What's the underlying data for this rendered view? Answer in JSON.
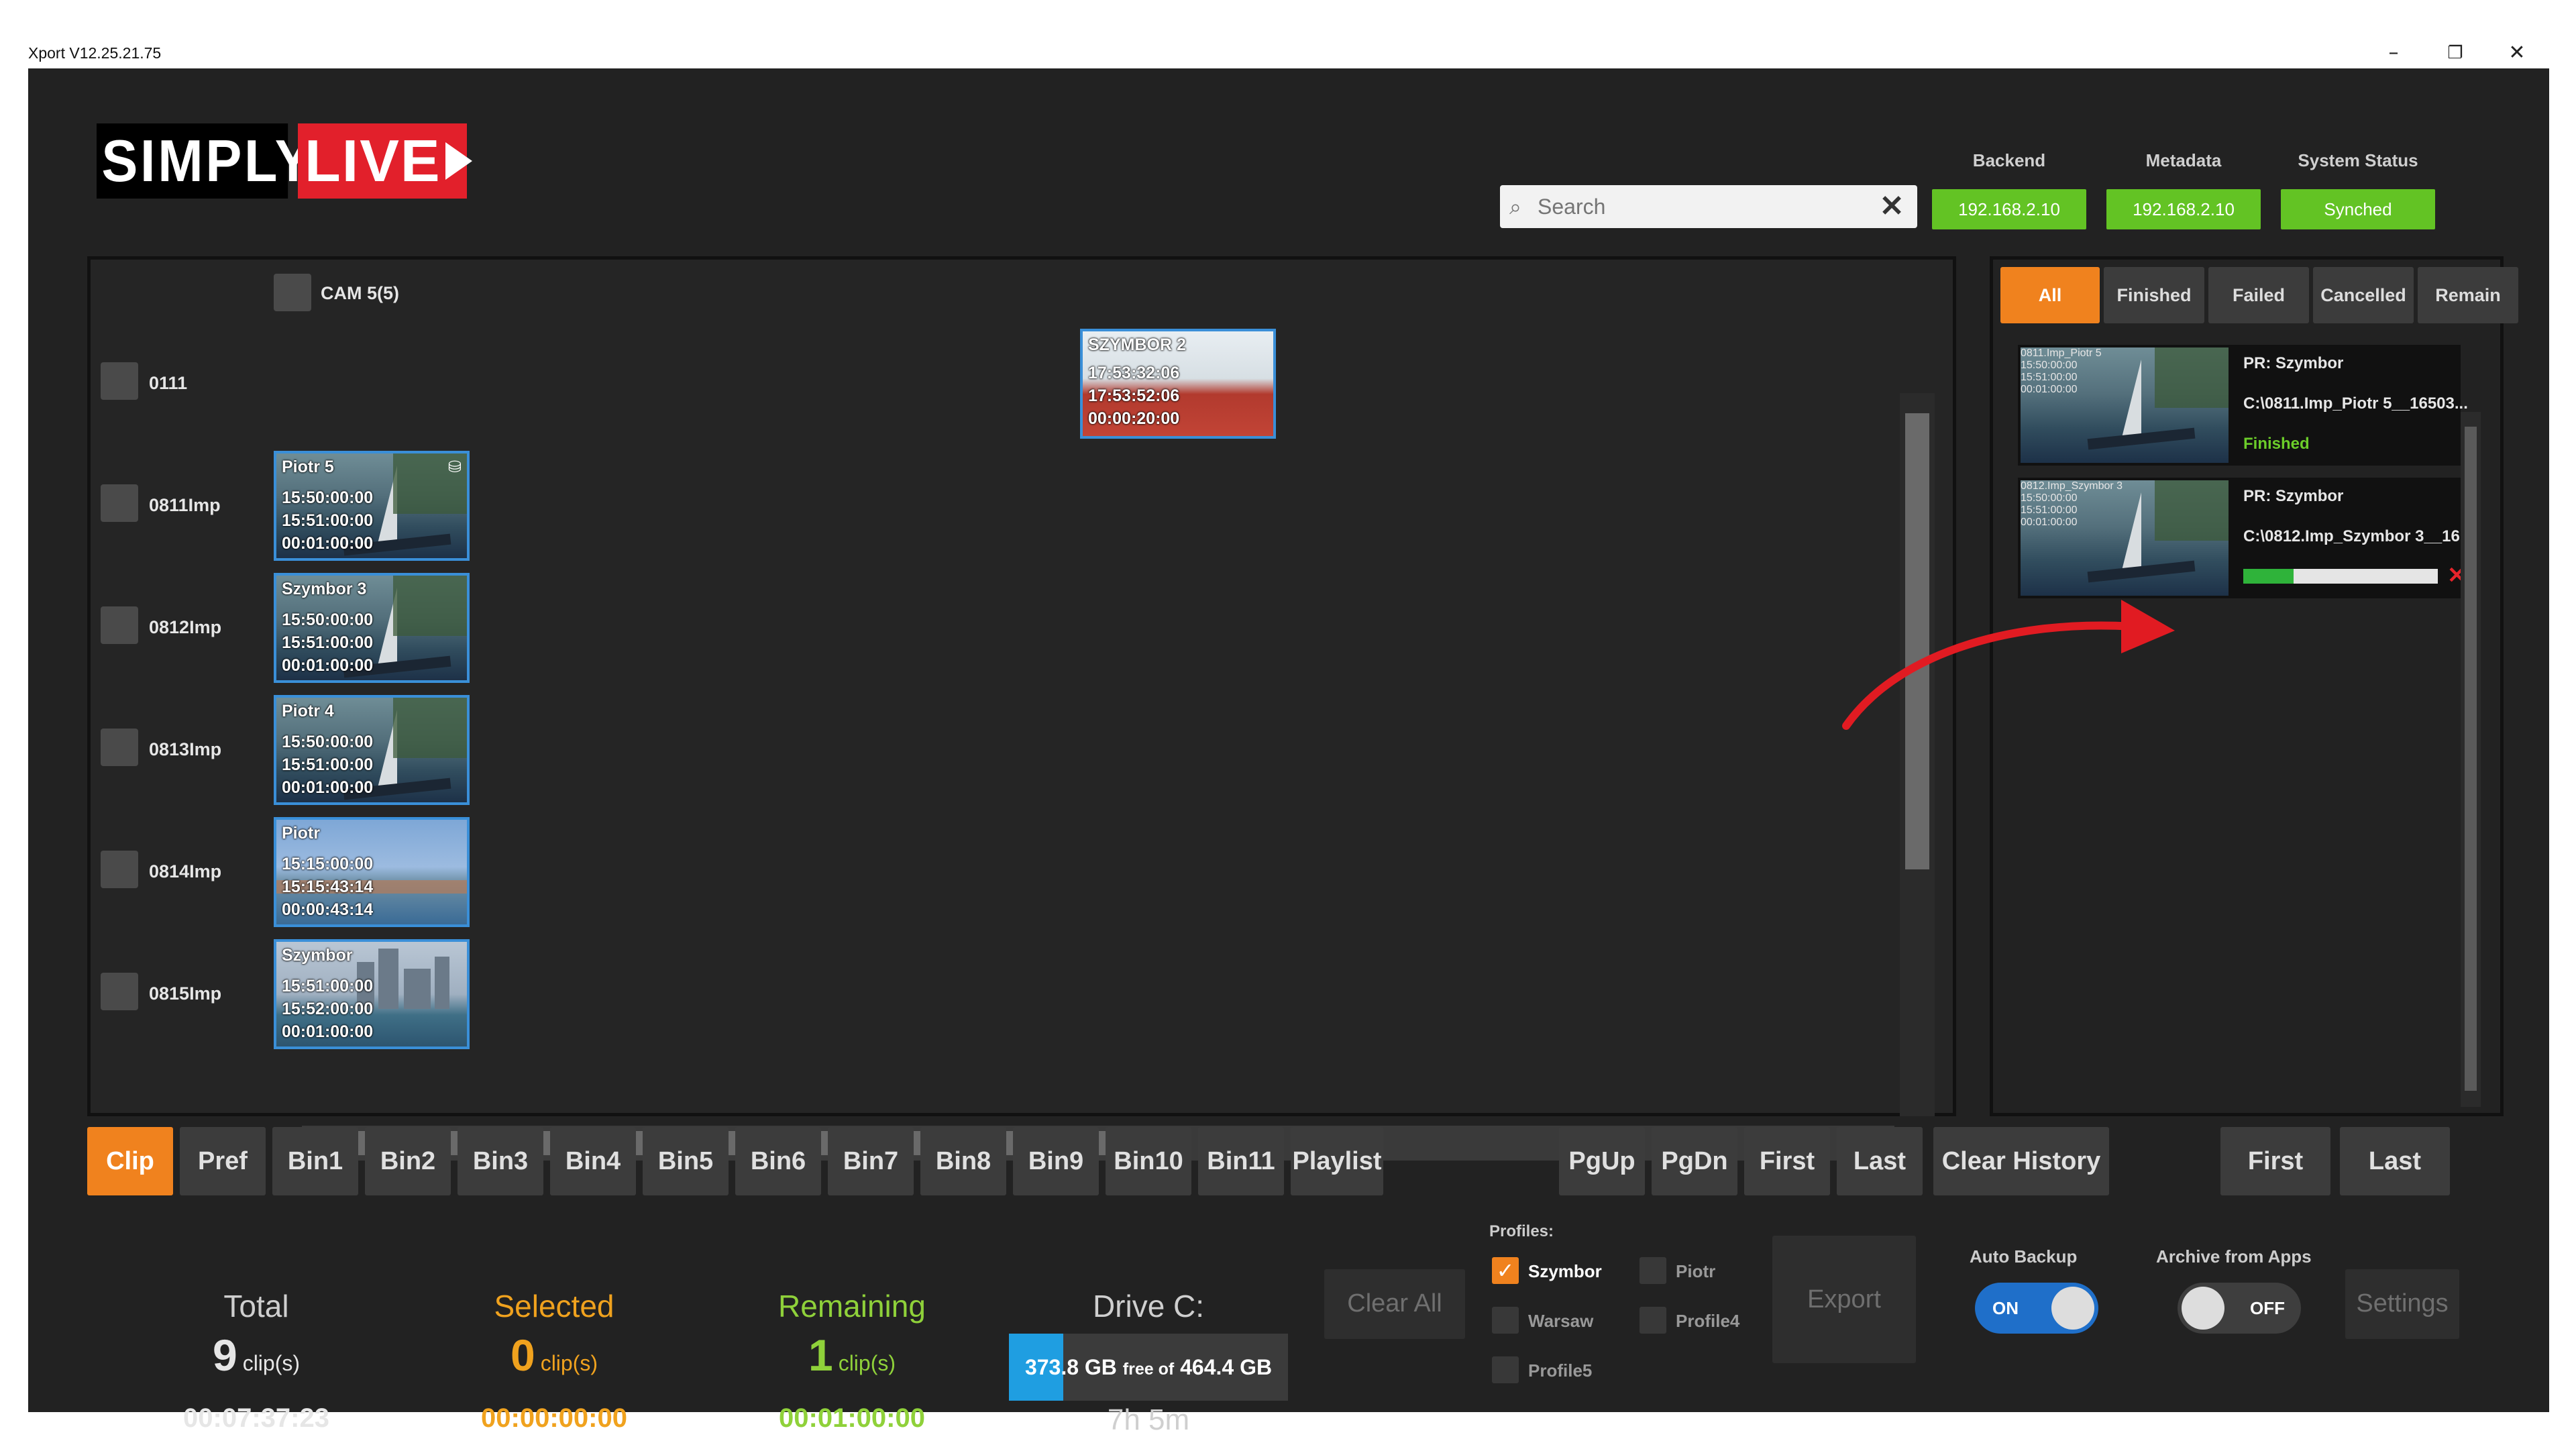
{
  "window": {
    "title": "Xport V12.25.21.75",
    "controls": [
      "–",
      "❐",
      "✕"
    ]
  },
  "logo": {
    "part1": "SIMPLY",
    "part2": "LIVE"
  },
  "search": {
    "placeholder": "Search",
    "value": ""
  },
  "status": {
    "backend_label": "Backend",
    "backend_value": "192.168.2.10",
    "metadata_label": "Metadata",
    "metadata_value": "192.168.2.10",
    "system_label": "System Status",
    "system_value": "Synched",
    "ok_color": "#63c324"
  },
  "clips": {
    "header_label": "CAM 5(5)",
    "top_clip": {
      "title": "SZYMBOR 2",
      "tc_in": "17:53:32:06",
      "tc_out": "17:53:52:06",
      "duration": "00:00:20:00"
    },
    "rows": [
      {
        "label": "0111"
      },
      {
        "label": "0811Imp",
        "title": "Piotr 5",
        "tc_in": "15:50:00:00",
        "tc_out": "15:51:00:00",
        "duration": "00:01:00:00"
      },
      {
        "label": "0812Imp",
        "title": "Szymbor 3",
        "tc_in": "15:50:00:00",
        "tc_out": "15:51:00:00",
        "duration": "00:01:00:00"
      },
      {
        "label": "0813Imp",
        "title": "Piotr 4",
        "tc_in": "15:50:00:00",
        "tc_out": "15:51:00:00",
        "duration": "00:01:00:00"
      },
      {
        "label": "0814Imp",
        "title": "Piotr",
        "tc_in": "15:15:00:00",
        "tc_out": "15:15:43:14",
        "duration": "00:00:43:14"
      },
      {
        "label": "0815Imp",
        "title": "Szymbor",
        "tc_in": "15:51:00:00",
        "tc_out": "15:52:00:00",
        "duration": "00:01:00:00"
      }
    ]
  },
  "history": {
    "tabs": [
      "All",
      "Finished",
      "Failed",
      "Cancelled",
      "Remain"
    ],
    "active_tab": "All",
    "items": [
      {
        "title": "0811.Imp_Piotr 5",
        "tc_in": "15:50:00:00",
        "tc_out": "15:51:00:00",
        "duration": "00:01:00:00",
        "pr": "PR: Szymbor",
        "path": "C:\\0811.Imp_Piotr 5__16503...",
        "status": "Finished"
      },
      {
        "title": "0812.Imp_Szymbor 3",
        "tc_in": "15:50:00:00",
        "tc_out": "15:51:00:00",
        "duration": "00:01:00:00",
        "pr": "PR: Szymbor",
        "path": "C:\\0812.Imp_Szymbor 3__16...",
        "progress": 0.26
      }
    ]
  },
  "bins": [
    "Clip",
    "Pref",
    "Bin1",
    "Bin2",
    "Bin3",
    "Bin4",
    "Bin5",
    "Bin6",
    "Bin7",
    "Bin8",
    "Bin9",
    "Bin10",
    "Bin11",
    "Playlist"
  ],
  "active_bin": "Clip",
  "paging": [
    "PgUp",
    "PgDn",
    "First",
    "Last"
  ],
  "history_buttons": {
    "clear": "Clear History",
    "first": "First",
    "last": "Last"
  },
  "stats": {
    "total": {
      "label": "Total",
      "count": "9",
      "unit": "clip(s)",
      "time": "00:07:37:23",
      "color": "#cfcfcf"
    },
    "selected": {
      "label": "Selected",
      "count": "0",
      "unit": "clip(s)",
      "time": "00:00:00:00",
      "color": "#f0a21e"
    },
    "remaining": {
      "label": "Remaining",
      "count": "1",
      "unit": "clip(s)",
      "time": "00:01:00:00",
      "color": "#8fd13a"
    }
  },
  "drive": {
    "label": "Drive C:",
    "free": "373.8 GB",
    "free_of": "free of",
    "total": "464.4 GB",
    "used_fraction": 0.195,
    "time_left": "7h 5m"
  },
  "clear_all": "Clear All",
  "profiles": {
    "label": "Profiles:",
    "items": [
      {
        "name": "Szymbor",
        "checked": true
      },
      {
        "name": "Piotr",
        "checked": false
      },
      {
        "name": "Warsaw",
        "checked": false
      },
      {
        "name": "Profile4",
        "checked": false
      },
      {
        "name": "Profile5",
        "checked": false
      }
    ]
  },
  "export": "Export",
  "auto_backup": {
    "label": "Auto Backup",
    "state": "ON"
  },
  "archive": {
    "label": "Archive from Apps",
    "state": "OFF"
  },
  "settings": "Settings",
  "accent_color": "#f0821e"
}
